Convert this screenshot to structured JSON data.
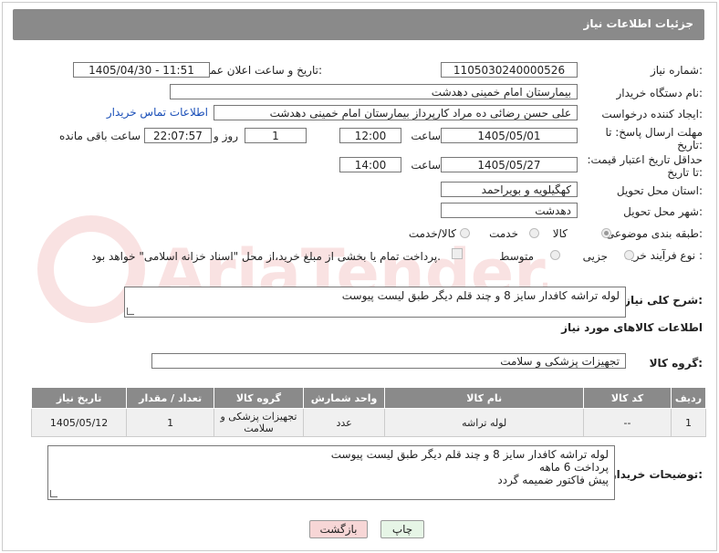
{
  "header": {
    "title": "جزئیات اطلاعات نیاز"
  },
  "fields": {
    "need_number_label": "شماره نیاز:",
    "need_number": "1105030240000526",
    "announce_label": "تاریخ و ساعت اعلان عمومی:",
    "announce_value": "1405/04/30 - 11:51",
    "buyer_org_label": "نام دستگاه خریدار:",
    "buyer_org": "بیمارستان امام خمینی دهدشت",
    "creator_label": "ایجاد کننده درخواست:",
    "creator": "علی حسن رضائی ده مراد کارپرداز بیمارستان امام خمینی دهدشت",
    "contact_link": "اطلاعات تماس خریدار",
    "deadline_label": "مهلت ارسال پاسخ: تا تاریخ:",
    "deadline_date": "1405/05/01",
    "time_word": "ساعت",
    "deadline_time": "12:00",
    "days_value": "1",
    "days_word": "روز و",
    "remaining_time": "22:07:57",
    "remaining_word": "ساعت باقی مانده",
    "price_validity_label": "حداقل تاریخ اعتبار قیمت: تا تاریخ:",
    "price_date": "1405/05/27",
    "price_time": "14:00",
    "province_label": "استان محل تحویل:",
    "province": "کهگیلویه و بویراحمد",
    "city_label": "شهر محل تحویل:",
    "city": "دهدشت",
    "category_label": "طبقه بندی موضوعی:",
    "category_options": [
      "کالا",
      "خدمت",
      "کالا/خدمت"
    ],
    "process_label": "نوع فرآیند خرید :",
    "process_options": [
      "جزیی",
      "متوسط"
    ],
    "payment_note": "پرداخت تمام یا بخشی از مبلغ خرید،از محل \"اسناد خزانه اسلامی\" خواهد بود."
  },
  "description": {
    "label": "شرح کلی نیاز:",
    "text": "لوله تراشه کافدار سایز 8 و چند قلم دیگر طبق لیست پیوست"
  },
  "goods_section": {
    "title": "اطلاعات کالاهای مورد نیاز",
    "group_label": "گروه کالا:",
    "group_value": "تجهیزات پزشکی و سلامت"
  },
  "table": {
    "headers": [
      "ردیف",
      "کد کالا",
      "نام کالا",
      "واحد شمارش",
      "گروه کالا",
      "تعداد / مقدار",
      "تاریخ نیاز"
    ],
    "rows": [
      [
        "1",
        "--",
        "لوله تراشه",
        "عدد",
        "تجهیزات پزشکی و سلامت",
        "1",
        "1405/05/12"
      ]
    ]
  },
  "buyer_notes": {
    "label": "توضیحات خریدار:",
    "lines": [
      "لوله تراشه کافدار سایز 8 و چند قلم دیگر طبق لیست پیوست",
      "پرداخت 6 ماهه",
      "پیش فاکتور ضمیمه گردد"
    ]
  },
  "buttons": {
    "print": "چاپ",
    "back": "بازگشت"
  },
  "watermark": "AriaTender.net",
  "colors": {
    "header_bg": "#8a8a8a",
    "link": "#1a4fb8",
    "back_btn": "#f7d6d6",
    "print_btn": "#e6f5e6"
  }
}
